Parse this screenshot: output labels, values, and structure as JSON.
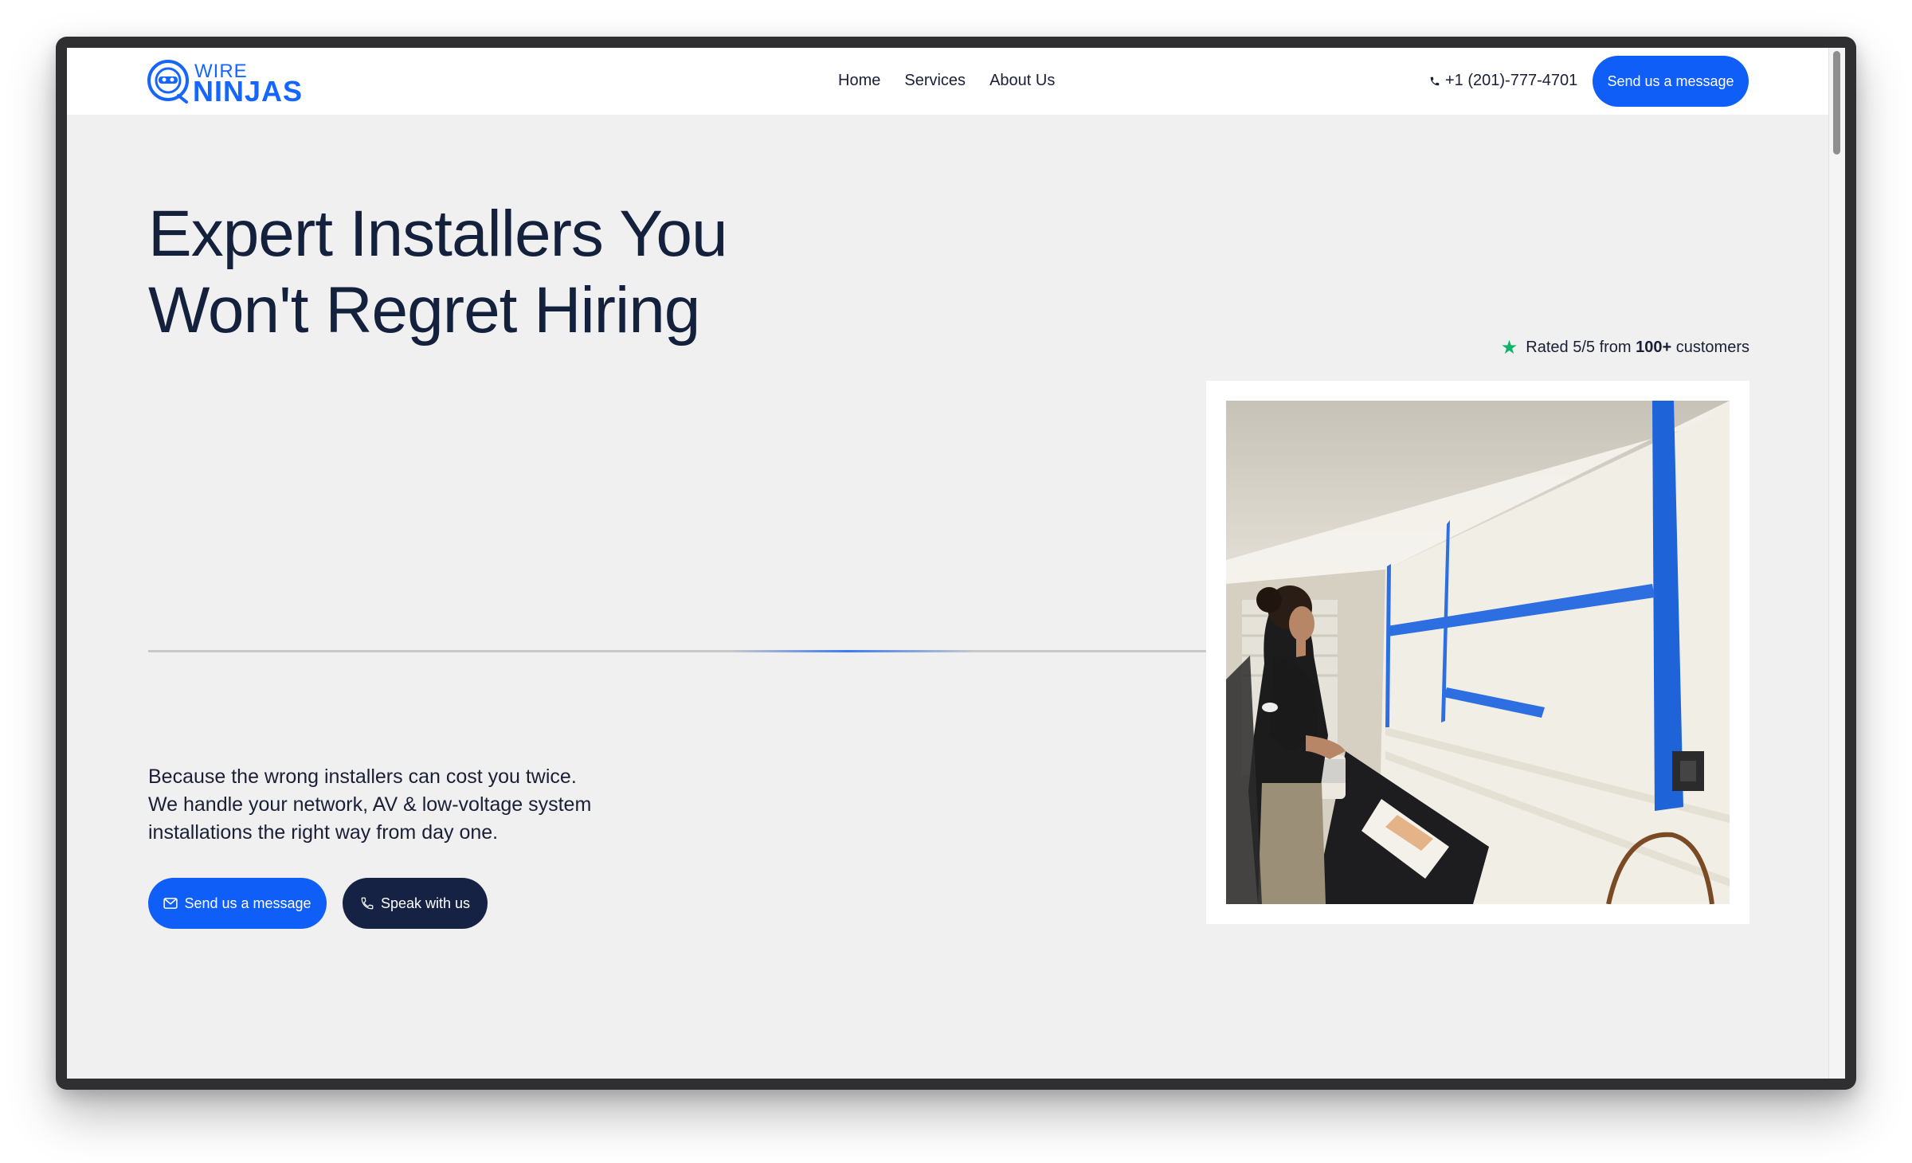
{
  "logo": {
    "line1": "WIRE",
    "line2": "NINJAS",
    "brand_color": "#1565ff"
  },
  "nav": {
    "links": [
      "Home",
      "Services",
      "About Us"
    ],
    "phone": "+1 (201)-777-4701",
    "phone_icon": "phone-icon",
    "cta_label": "Send us a message"
  },
  "hero": {
    "title_line1": "Expert Installers You",
    "title_line2": "Won't Regret Hiring",
    "rating_prefix": "Rated 5/5 from ",
    "rating_count": "100+",
    "rating_suffix": " customers",
    "rating_icon": "star-icon",
    "description_line1": "Because the wrong installers can cost you twice.",
    "description_line2": "We handle your network, AV & low-voltage system",
    "description_line3": "installations the right way from day one.",
    "primary_cta": "Send us a message",
    "primary_cta_icon": "mail-icon",
    "secondary_cta": "Speak with us",
    "secondary_cta_icon": "phone-icon"
  },
  "colors": {
    "primary_blue": "#0f5ef7",
    "navy": "#152244",
    "hero_background": "#f0f0f0",
    "star_green": "#0cb36b"
  }
}
